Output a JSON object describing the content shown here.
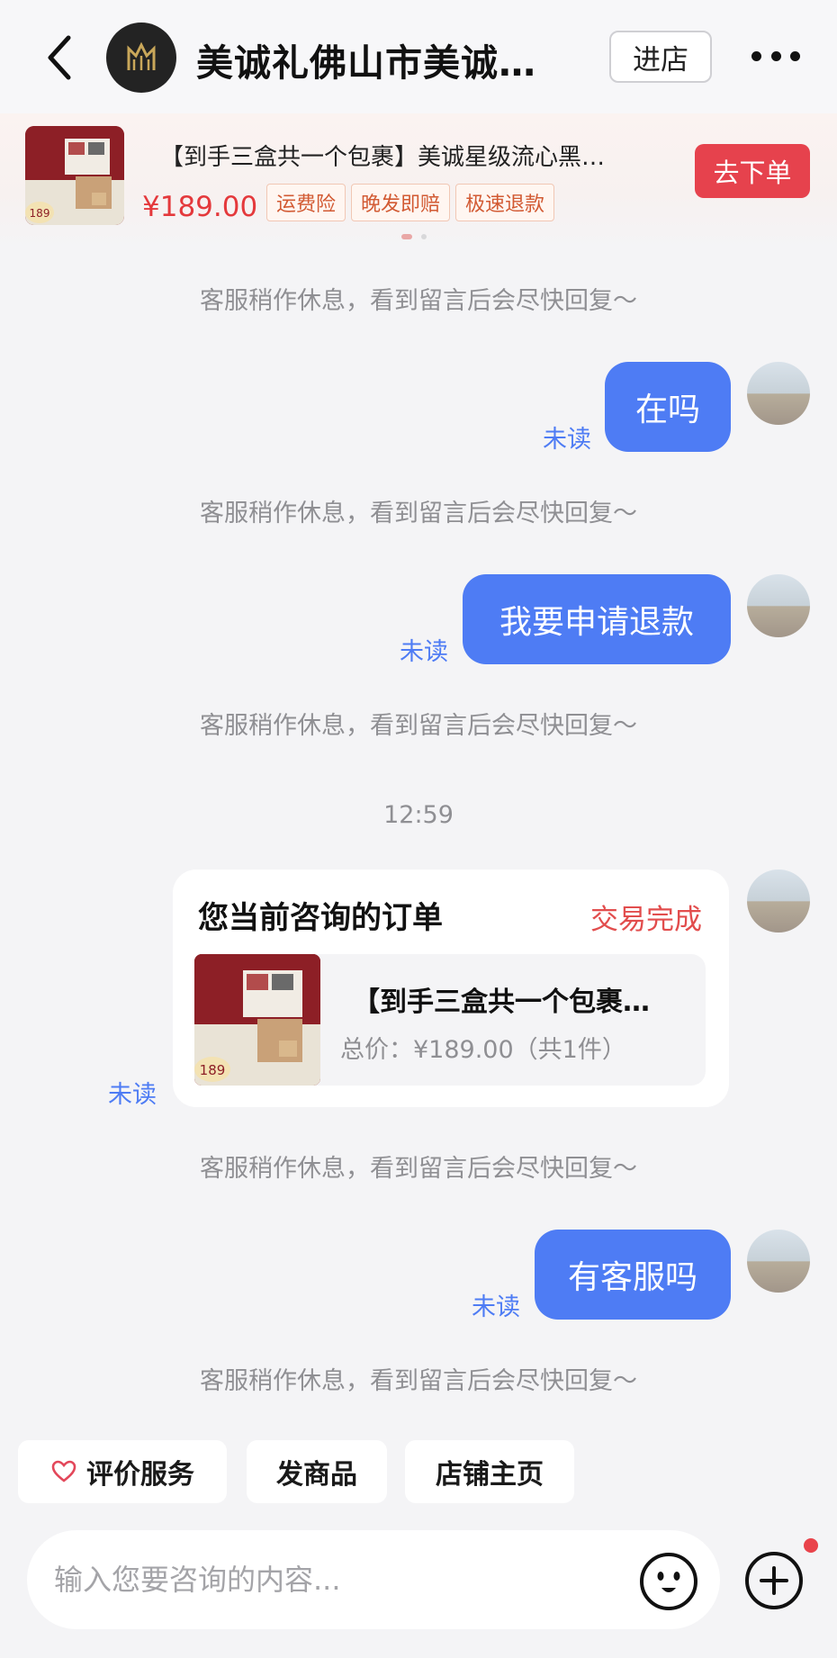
{
  "header": {
    "shop_name": "美诚礼佛山市美诚…",
    "enter_store": "进店"
  },
  "product": {
    "title": "【到手三盒共一个包裹】美诚星级流心黑…",
    "price": "¥189.00",
    "tags": [
      "运费险",
      "晚发即赔",
      "极速退款"
    ],
    "order_button": "去下单",
    "thumb_price": "189"
  },
  "chat": {
    "system_notice": "客服稍作休息，看到留言后会尽快回复～",
    "unread": "未读",
    "messages": [
      "在吗",
      "我要申请退款",
      "有客服吗"
    ],
    "time": "12:59",
    "order_card": {
      "title": "您当前咨询的订单",
      "status": "交易完成",
      "product_name": "【到手三盒共一个包裹…",
      "total": "总价：¥189.00（共1件）"
    }
  },
  "quick_actions": [
    "评价服务",
    "发商品",
    "店铺主页"
  ],
  "input": {
    "placeholder": "输入您要咨询的内容..."
  },
  "colors": {
    "bubble": "#4e7cf4",
    "accent_red": "#e6424d"
  }
}
